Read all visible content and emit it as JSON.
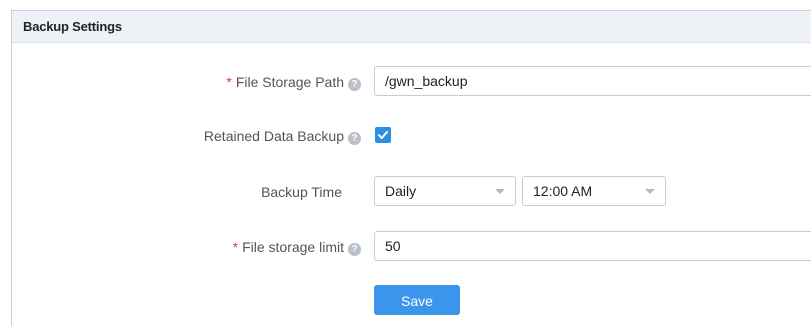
{
  "panel": {
    "title": "Backup Settings"
  },
  "form": {
    "file_storage_path": {
      "required_mark": "*",
      "label": "File Storage Path",
      "value": "/gwn_backup"
    },
    "retained_data_backup": {
      "label": "Retained Data Backup",
      "checked": true
    },
    "backup_time": {
      "label": "Backup Time",
      "frequency_value": "Daily",
      "time_value": "12:00 AM"
    },
    "file_storage_limit": {
      "required_mark": "*",
      "label": "File storage limit",
      "value": "50"
    },
    "save_label": "Save"
  },
  "icons": {
    "help": "help-icon",
    "caret": "chevron-down-icon",
    "check": "checkmark-icon"
  },
  "colors": {
    "accent": "#3c95ec",
    "checkbox": "#2f8de4",
    "required": "#e03a3a",
    "header_bg": "#eef2f6"
  }
}
